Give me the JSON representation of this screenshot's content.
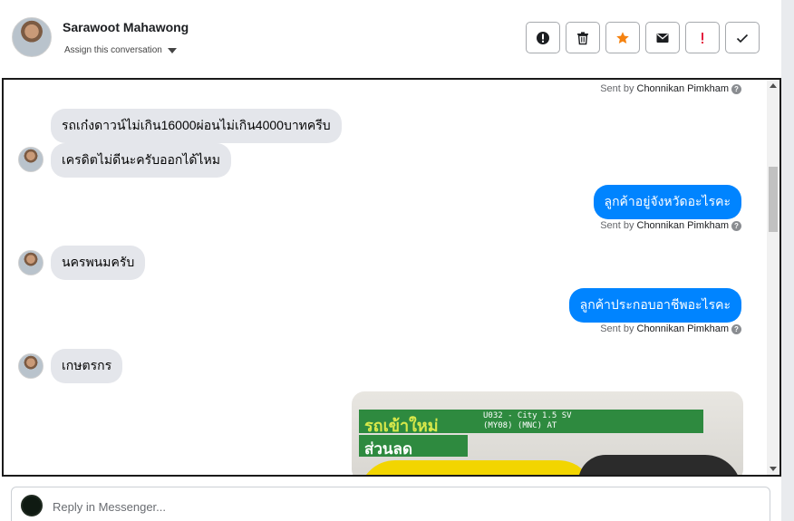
{
  "header": {
    "contact_name": "Sarawoot Mahawong",
    "assign_label": "Assign this conversation",
    "actions": [
      "alert-circle-icon",
      "trash-icon",
      "star-icon",
      "mail-icon",
      "exclamation-icon",
      "check-icon"
    ]
  },
  "conversation": {
    "sent_by_prefix": "Sent by",
    "agent_name": "Chonnikan Pimkham",
    "messages": [
      {
        "direction": "in",
        "text": "รถเก๋งดาวน์ไม่เกิน16000ผ่อนไม่เกิน4000บาทครีบ"
      },
      {
        "direction": "in",
        "text": "เครดิตไม่ดีนะครับออกได้ไหม"
      },
      {
        "direction": "out",
        "text": "ลูกค้าอยู่จังหวัดอะไรคะ"
      },
      {
        "direction": "in",
        "text": "นครพนมครับ"
      },
      {
        "direction": "out",
        "text": "ลูกค้าประกอบอาชีพอะไรคะ"
      },
      {
        "direction": "in",
        "text": "เกษตรกร"
      }
    ],
    "promo": {
      "line1": "รถเข้าใหม่",
      "line2": "ส่วนลด",
      "spec_line1": "U032 - City 1.5 SV",
      "spec_line2": "(MY08) (MNC) AT"
    }
  },
  "reply": {
    "placeholder": "Reply in Messenger..."
  },
  "colors": {
    "outgoing_bubble": "#0084ff",
    "incoming_bubble": "#e4e6eb",
    "star": "#f5820f",
    "flag_red": "#e41e3f"
  }
}
